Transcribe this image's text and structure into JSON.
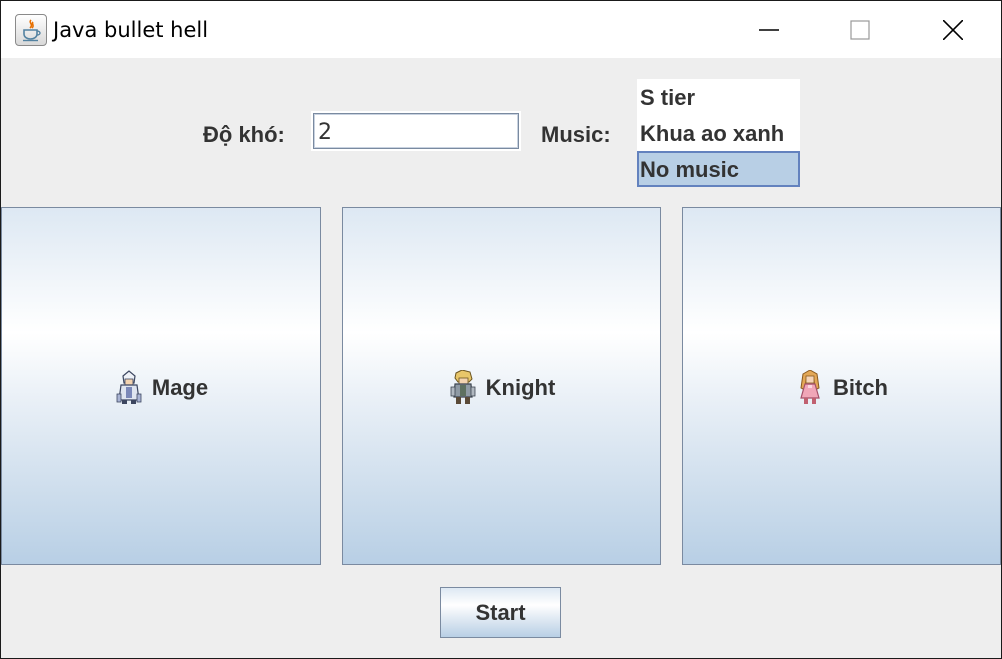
{
  "window": {
    "title": "Java bullet hell",
    "icon": "java-coffee-icon"
  },
  "settings": {
    "difficulty_label": "Độ khó:",
    "difficulty_value": "2",
    "music_label": "Music:",
    "music_options": [
      {
        "label": "S tier",
        "selected": false
      },
      {
        "label": "Khua ao xanh",
        "selected": false
      },
      {
        "label": "No music",
        "selected": true
      }
    ]
  },
  "characters": [
    {
      "label": "Mage",
      "icon": "mage-sprite-icon"
    },
    {
      "label": "Knight",
      "icon": "knight-sprite-icon"
    },
    {
      "label": "Bitch",
      "icon": "girl-sprite-icon"
    }
  ],
  "start_label": "Start",
  "colors": {
    "accent": "#b8cfe5",
    "selection_border": "#6382be",
    "text": "#333333"
  }
}
